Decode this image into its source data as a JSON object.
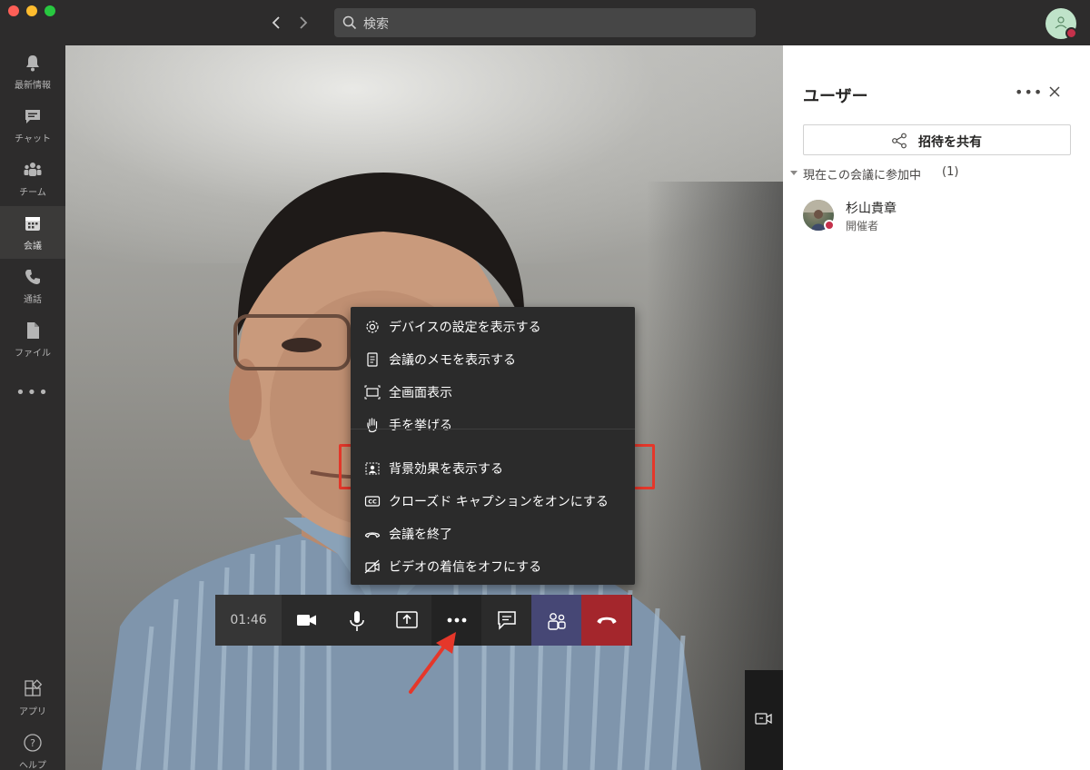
{
  "titlebar": {
    "search_placeholder": "検索"
  },
  "rail": {
    "items": [
      {
        "label": "最新情報",
        "icon": "bell-icon"
      },
      {
        "label": "チャット",
        "icon": "chat-icon"
      },
      {
        "label": "チーム",
        "icon": "teams-icon"
      },
      {
        "label": "会議",
        "icon": "calendar-icon"
      },
      {
        "label": "通話",
        "icon": "phone-icon"
      },
      {
        "label": "ファイル",
        "icon": "file-icon"
      }
    ],
    "more": "•••",
    "bottom": [
      {
        "label": "アプリ",
        "icon": "apps-icon"
      },
      {
        "label": "ヘルプ",
        "icon": "help-icon"
      }
    ]
  },
  "menu": {
    "items": [
      {
        "label": "デバイスの設定を表示する",
        "icon": "gear-icon"
      },
      {
        "label": "会議のメモを表示する",
        "icon": "notes-icon"
      },
      {
        "label": "全画面表示",
        "icon": "fullscreen-icon"
      },
      {
        "label": "手を挙げる",
        "icon": "raise-hand-icon"
      },
      {
        "label": "背景効果を表示する",
        "icon": "background-effects-icon"
      },
      {
        "label": "クローズド キャプションをオンにする",
        "icon": "closed-caption-icon"
      },
      {
        "label": "会議を終了",
        "icon": "end-meeting-icon"
      },
      {
        "label": "ビデオの着信をオフにする",
        "icon": "video-off-icon"
      }
    ]
  },
  "callbar": {
    "timer": "01:46",
    "more": "•••"
  },
  "panel": {
    "title": "ユーザー",
    "more": "•••",
    "invite_label": "招待を共有",
    "section_label": "現在この会議に参加中",
    "section_count": "(1)",
    "user": {
      "name": "杉山貴章",
      "role": "開催者"
    }
  },
  "colors": {
    "accent": "#6264a7",
    "hangup": "#a4262c",
    "highlight": "#e5372a",
    "status_busy": "#c4314b"
  }
}
